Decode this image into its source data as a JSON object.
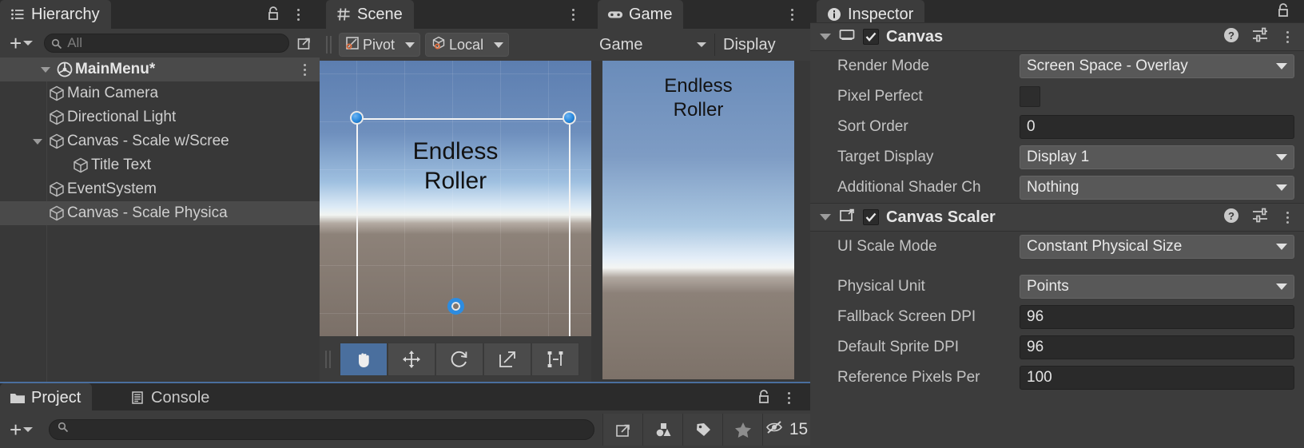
{
  "hierarchy": {
    "tab_label": "Hierarchy",
    "tab_icon": "hierarchy-list-icon",
    "add_label": "+",
    "search_placeholder": "All",
    "scene_name": "MainMenu*",
    "items": [
      {
        "label": "Main Camera",
        "depth": 2,
        "expandable": false,
        "selected": false
      },
      {
        "label": "Directional Light",
        "depth": 2,
        "expandable": false,
        "selected": false
      },
      {
        "label": "Canvas - Scale w/Scree",
        "depth": 2,
        "expandable": true,
        "selected": false
      },
      {
        "label": "Title Text",
        "depth": 3,
        "expandable": false,
        "selected": false
      },
      {
        "label": "EventSystem",
        "depth": 2,
        "expandable": false,
        "selected": false
      },
      {
        "label": "Canvas - Scale Physica",
        "depth": 2,
        "expandable": false,
        "selected": true
      }
    ]
  },
  "scene": {
    "tab_label": "Scene",
    "tab_icon": "grid-icon",
    "pivot_label": "Pivot",
    "handle_space_label": "Local",
    "overlay_text_line1": "Endless",
    "overlay_text_line2": "Roller",
    "tools": [
      {
        "name": "hand-tool",
        "active": true
      },
      {
        "name": "move-tool",
        "active": false
      },
      {
        "name": "rotate-tool",
        "active": false
      },
      {
        "name": "scale-tool",
        "active": false
      },
      {
        "name": "rect-tool",
        "active": false
      }
    ]
  },
  "game": {
    "tab_label": "Game",
    "tab_icon": "gamepad-icon",
    "aspect_label": "Game",
    "display_label": "Display",
    "overlay_text_line1": "Endless",
    "overlay_text_line2": "Roller"
  },
  "inspector": {
    "tab_label": "Inspector",
    "tab_icon": "info-icon",
    "components": [
      {
        "name": "Canvas",
        "icon": "canvas-icon",
        "enabled": true,
        "fields": [
          {
            "label": "Render Mode",
            "value": "Screen Space - Overlay",
            "type": "dropdown"
          },
          {
            "label": "Pixel Perfect",
            "value": "",
            "type": "checkbox",
            "checked": false
          },
          {
            "label": "Sort Order",
            "value": "0",
            "type": "text"
          },
          {
            "label": "Target Display",
            "value": "Display 1",
            "type": "dropdown"
          },
          {
            "label": "Additional Shader Ch",
            "value": "Nothing",
            "type": "dropdown"
          }
        ]
      },
      {
        "name": "Canvas Scaler",
        "icon": "canvas-scaler-icon",
        "enabled": true,
        "fields": [
          {
            "label": "UI Scale Mode",
            "value": "Constant Physical Size",
            "type": "dropdown"
          },
          {
            "label": "Physical Unit",
            "value": "Points",
            "type": "dropdown",
            "gap_before": true
          },
          {
            "label": "Fallback Screen DPI",
            "value": "96",
            "type": "text"
          },
          {
            "label": "Default Sprite DPI",
            "value": "96",
            "type": "text"
          },
          {
            "label": "Reference Pixels Per",
            "value": "100",
            "type": "text"
          }
        ]
      }
    ]
  },
  "bottom": {
    "tabs": [
      {
        "label": "Project",
        "icon": "folder-icon",
        "active": true
      },
      {
        "label": "Console",
        "icon": "console-icon",
        "active": false
      }
    ],
    "add_label": "+",
    "search_placeholder": "",
    "filter_buttons": [
      {
        "name": "search-expand-icon"
      },
      {
        "name": "shapes-filter-icon"
      },
      {
        "name": "label-filter-icon"
      },
      {
        "name": "favorites-star-icon"
      },
      {
        "name": "hidden-eye-icon"
      }
    ],
    "hidden_count": "15"
  },
  "colors": {
    "accent": "#4a6f9e",
    "panel_bg": "#3c3c3c",
    "tabstrip_bg": "#2b2b2b",
    "selected_row": "#4a4a4a",
    "handle_blue": "#2d8ce0"
  }
}
